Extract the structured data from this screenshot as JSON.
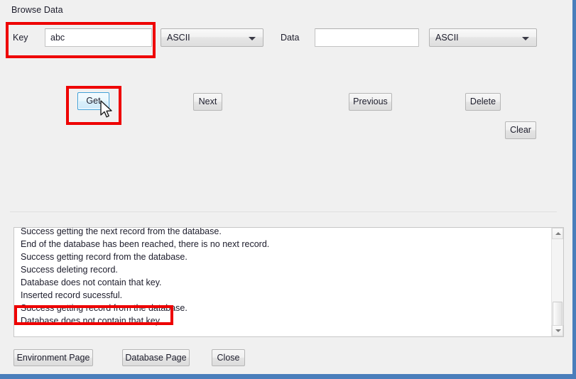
{
  "window": {
    "group_title": "Browse Data",
    "accent_color": "#4a7ebb",
    "background_color": "#f0f0f0",
    "annotation_color": "#ee0000",
    "hover_border_color": "#3c9fd8"
  },
  "form": {
    "key": {
      "label": "Key",
      "value": "abc",
      "placeholder": "",
      "encoding_selected": "ASCII"
    },
    "data": {
      "label": "Data",
      "value": "",
      "placeholder": "",
      "encoding_selected": "ASCII"
    }
  },
  "actions": {
    "get": "Get",
    "next": "Next",
    "previous": "Previous",
    "delete": "Delete",
    "clear": "Clear"
  },
  "log": {
    "lines": [
      "Success getting the next record from the database.",
      "End of the database has been reached, there is no next record.",
      "Success getting record from the database.",
      "Success deleting record.",
      "Database does not contain that key.",
      "Inserted record sucessful.",
      "Success getting record from the database.",
      "Database does not contain that key."
    ]
  },
  "footer": {
    "environment_page": "Environment Page",
    "database_page": "Database Page",
    "close": "Close"
  }
}
